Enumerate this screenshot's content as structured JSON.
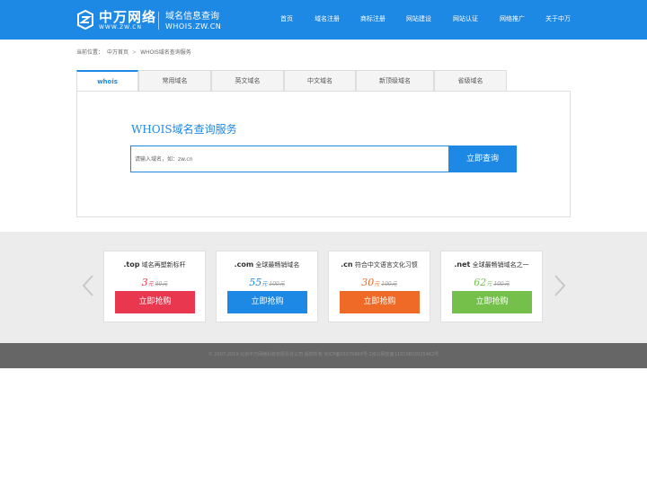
{
  "header": {
    "logo_text": "中万网络",
    "logo_sub": "WWW.ZW.CN",
    "site_title": "域名信息查询",
    "site_domain": "WHOIS.ZW.CN",
    "nav": [
      "首页",
      "域名注册",
      "商标注册",
      "网站建设",
      "网站认证",
      "网络推广",
      "关于中万"
    ]
  },
  "breadcrumb": {
    "prefix": "当前位置：",
    "home": "中万首页",
    "separator": ">",
    "current": "WHOIS域名查询服务"
  },
  "tabs": [
    "whois",
    "常用域名",
    "英文域名",
    "中文域名",
    "新顶级域名",
    "省级域名"
  ],
  "active_tab": 0,
  "search": {
    "title": "WHOIS域名查询服务",
    "placeholder": "请输入域名，如：zw.cn",
    "button": "立即查询"
  },
  "promo": {
    "cards": [
      {
        "ext": ".top",
        "desc": "域名再塑新标杆",
        "price": "3",
        "unit": "元",
        "old_price": "80元",
        "button": "立即抢购",
        "color": "#e9374f",
        "price_color": "#e9374f"
      },
      {
        "ext": ".com",
        "desc": "全球最畅销域名",
        "price": "55",
        "unit": "元",
        "old_price": "100元",
        "button": "立即抢购",
        "color": "#1e88e5",
        "price_color": "#1e88e5"
      },
      {
        "ext": ".cn",
        "desc": "符合中文语言文化习惯",
        "price": "30",
        "unit": "元",
        "old_price": "100元",
        "button": "立即抢购",
        "color": "#f06a27",
        "price_color": "#f06a27"
      },
      {
        "ext": ".net",
        "desc": "全球最畅销域名之一",
        "price": "62",
        "unit": "元",
        "old_price": "100元",
        "button": "立即抢购",
        "color": "#74c04a",
        "price_color": "#74c04a"
      }
    ]
  },
  "footer": {
    "text": "© 2007-2019 北京中万网络科技有限责任公司 版权所有 京ICP备05075869号-1京公网安备11010802025462号"
  },
  "colors": {
    "brand": "#1e88e5",
    "footer_bg": "#666666",
    "promo_bg": "#ececec"
  }
}
